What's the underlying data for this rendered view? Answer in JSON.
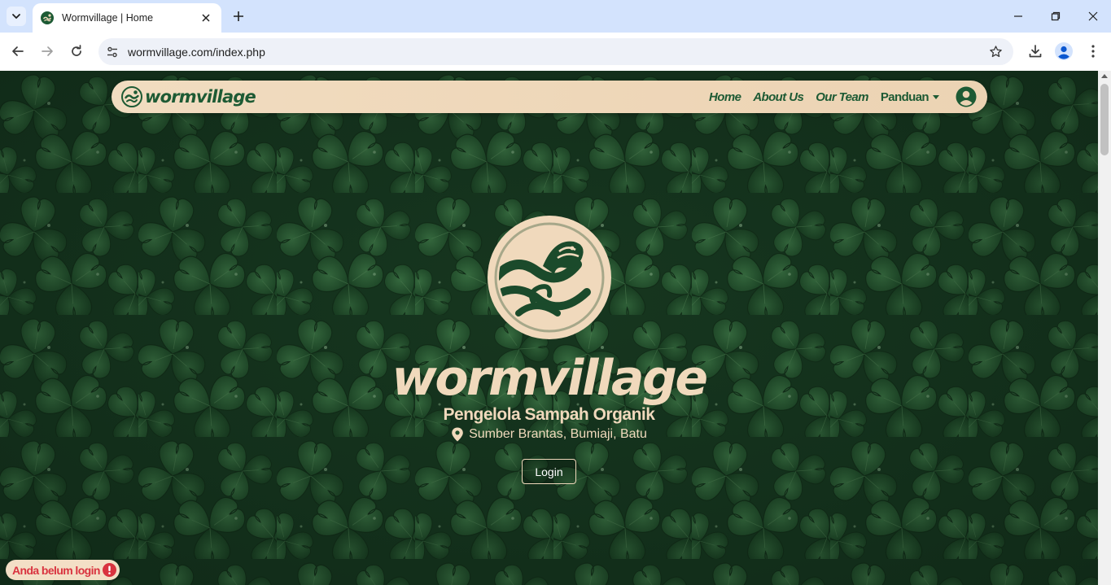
{
  "browser": {
    "tab_title": "Wormvillage | Home",
    "url": "wormvillage.com/index.php"
  },
  "colors": {
    "nav_bg": "#ecd3b3",
    "brand_green": "#1d5a34",
    "cream": "#f0d9bc",
    "warning_red": "#d9333f"
  },
  "navbar": {
    "brand": "wormvillage",
    "links": [
      {
        "label": "Home"
      },
      {
        "label": "About Us"
      },
      {
        "label": "Our Team"
      },
      {
        "label": "Panduan"
      }
    ],
    "user_icon": "user-circle-icon"
  },
  "hero": {
    "title": "wormvillage",
    "subtitle": "Pengelola Sampah Organik",
    "location": "Sumber Brantas, Bumiaji, Batu",
    "login_label": "Login"
  },
  "status": {
    "text": "Anda belum login",
    "icon": "exclamation-circle-icon"
  }
}
